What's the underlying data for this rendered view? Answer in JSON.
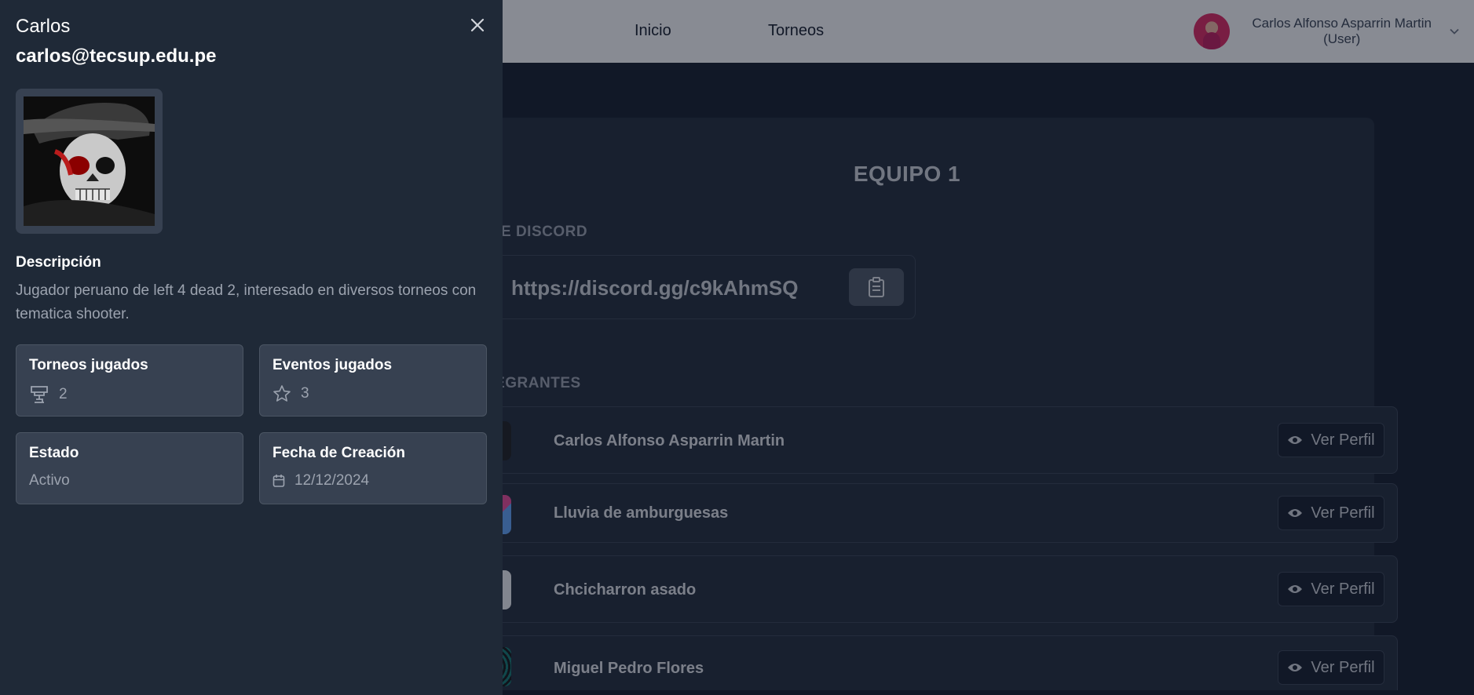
{
  "navbar": {
    "links": [
      "Inicio",
      "Torneos"
    ],
    "user_name": "Carlos Alfonso Asparrin Martin",
    "user_role": "(User)"
  },
  "team": {
    "title": "EQUIPO 1",
    "discord_label": "IK DE DISCORD",
    "discord_link": "https://discord.gg/c9kAhmSQ",
    "members_label": "TEGRANTES",
    "view_label": "Ver Perfil",
    "members": [
      {
        "name": "Carlos Alfonso Asparrin Martin"
      },
      {
        "name": "Lluvia de amburguesas"
      },
      {
        "name": "Chcicharron asado"
      },
      {
        "name": "Miguel Pedro Flores"
      }
    ]
  },
  "drawer": {
    "name": "Carlos",
    "email": "carlos@tecsup.edu.pe",
    "description_heading": "Descripción",
    "description": "Jugador peruano de left 4 dead 2, interesado en diversos torneos con tematica shooter.",
    "stats": {
      "tournaments_label": "Torneos jugados",
      "tournaments_value": "2",
      "events_label": "Eventos jugados",
      "events_value": "3",
      "status_label": "Estado",
      "status_value": "Activo",
      "created_label": "Fecha de Creación",
      "created_value": "12/12/2024"
    }
  },
  "colors": {
    "drawer_bg": "#1f2937",
    "card_bg": "#374151",
    "page_bg": "#111827"
  }
}
